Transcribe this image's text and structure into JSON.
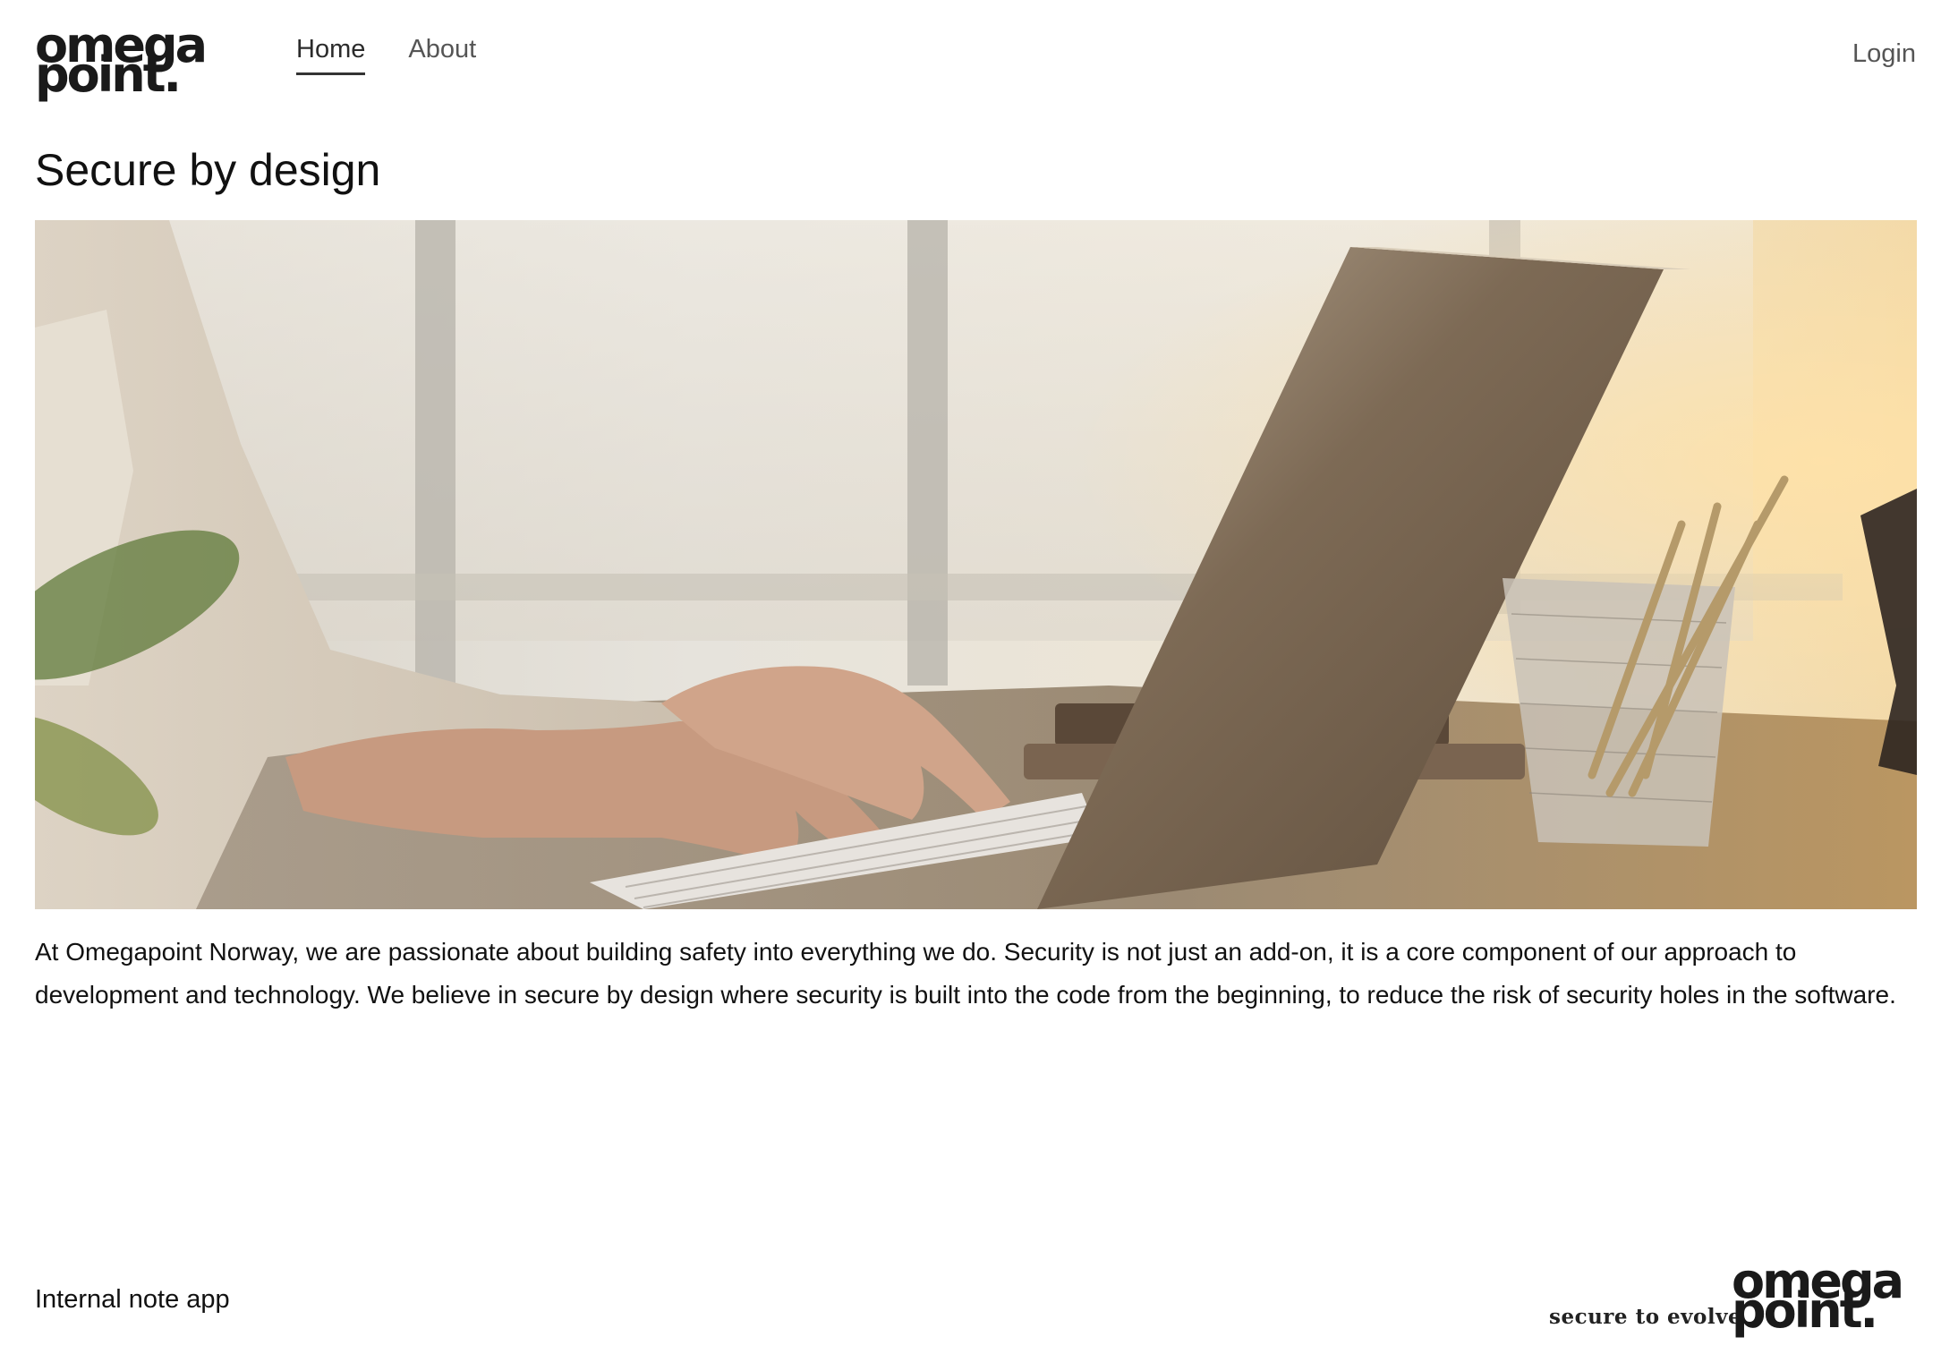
{
  "header": {
    "logo": {
      "line1": "omega",
      "line2": "point."
    },
    "nav": [
      {
        "label": "Home",
        "active": true
      },
      {
        "label": "About",
        "active": false
      }
    ],
    "login_label": "Login"
  },
  "main": {
    "title": "Secure by design",
    "hero_image": {
      "icon": "laptop-typing-photo"
    },
    "intro": "At Omegapoint Norway, we are passionate about building safety into everything we do. Security is not just an add-on, it is a core component of our approach to development and technology. We believe in secure by design where security is built into the code from the beginning, to reduce the risk of security holes in the software."
  },
  "footer": {
    "app_name": "Internal note app",
    "tagline": "secure to evolve",
    "logo": {
      "line1": "omega",
      "line2": "point."
    }
  },
  "colors": {
    "text": "#1a1a1a",
    "nav_inactive": "#555555",
    "background": "#ffffff"
  }
}
